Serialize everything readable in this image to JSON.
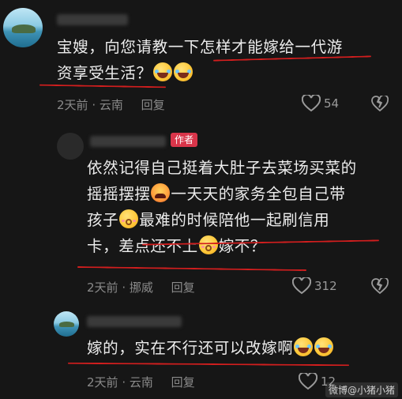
{
  "comments": [
    {
      "text_lines": [
        "宝嫂，向您请教一下怎样才能嫁给一代游",
        "资享受生活？"
      ],
      "meta": {
        "time": "2天前",
        "location": "云南",
        "reply_label": "回复"
      },
      "likes": "54"
    },
    {
      "author_badge": "作者",
      "text_lines": [
        "依然记得自己挺着大肚子去菜场买菜的",
        "摇摇摆摆",
        "一天天的家务全包自己带",
        "孩子",
        "最难的时候陪他一起刷信用",
        "卡，差点还不上",
        "嫁不？"
      ],
      "meta": {
        "time": "2天前",
        "location": "挪威",
        "reply_label": "回复"
      },
      "likes": "312"
    },
    {
      "text_lines": [
        "嫁的，实在不行还可以改嫁啊"
      ],
      "meta": {
        "time": "2天前",
        "location": "云南",
        "reply_label": "回复"
      },
      "likes": "12"
    }
  ],
  "watermark": "微博@小猪小猪",
  "colors": {
    "background": "#161616",
    "underline": "#d21e1e",
    "badge": "#d9354a",
    "meta": "#8a8a8a"
  },
  "icons": [
    "heart-icon",
    "broken-heart-icon",
    "laughing-crying-emoji",
    "angry-face-emoji",
    "shy-face-emoji"
  ]
}
